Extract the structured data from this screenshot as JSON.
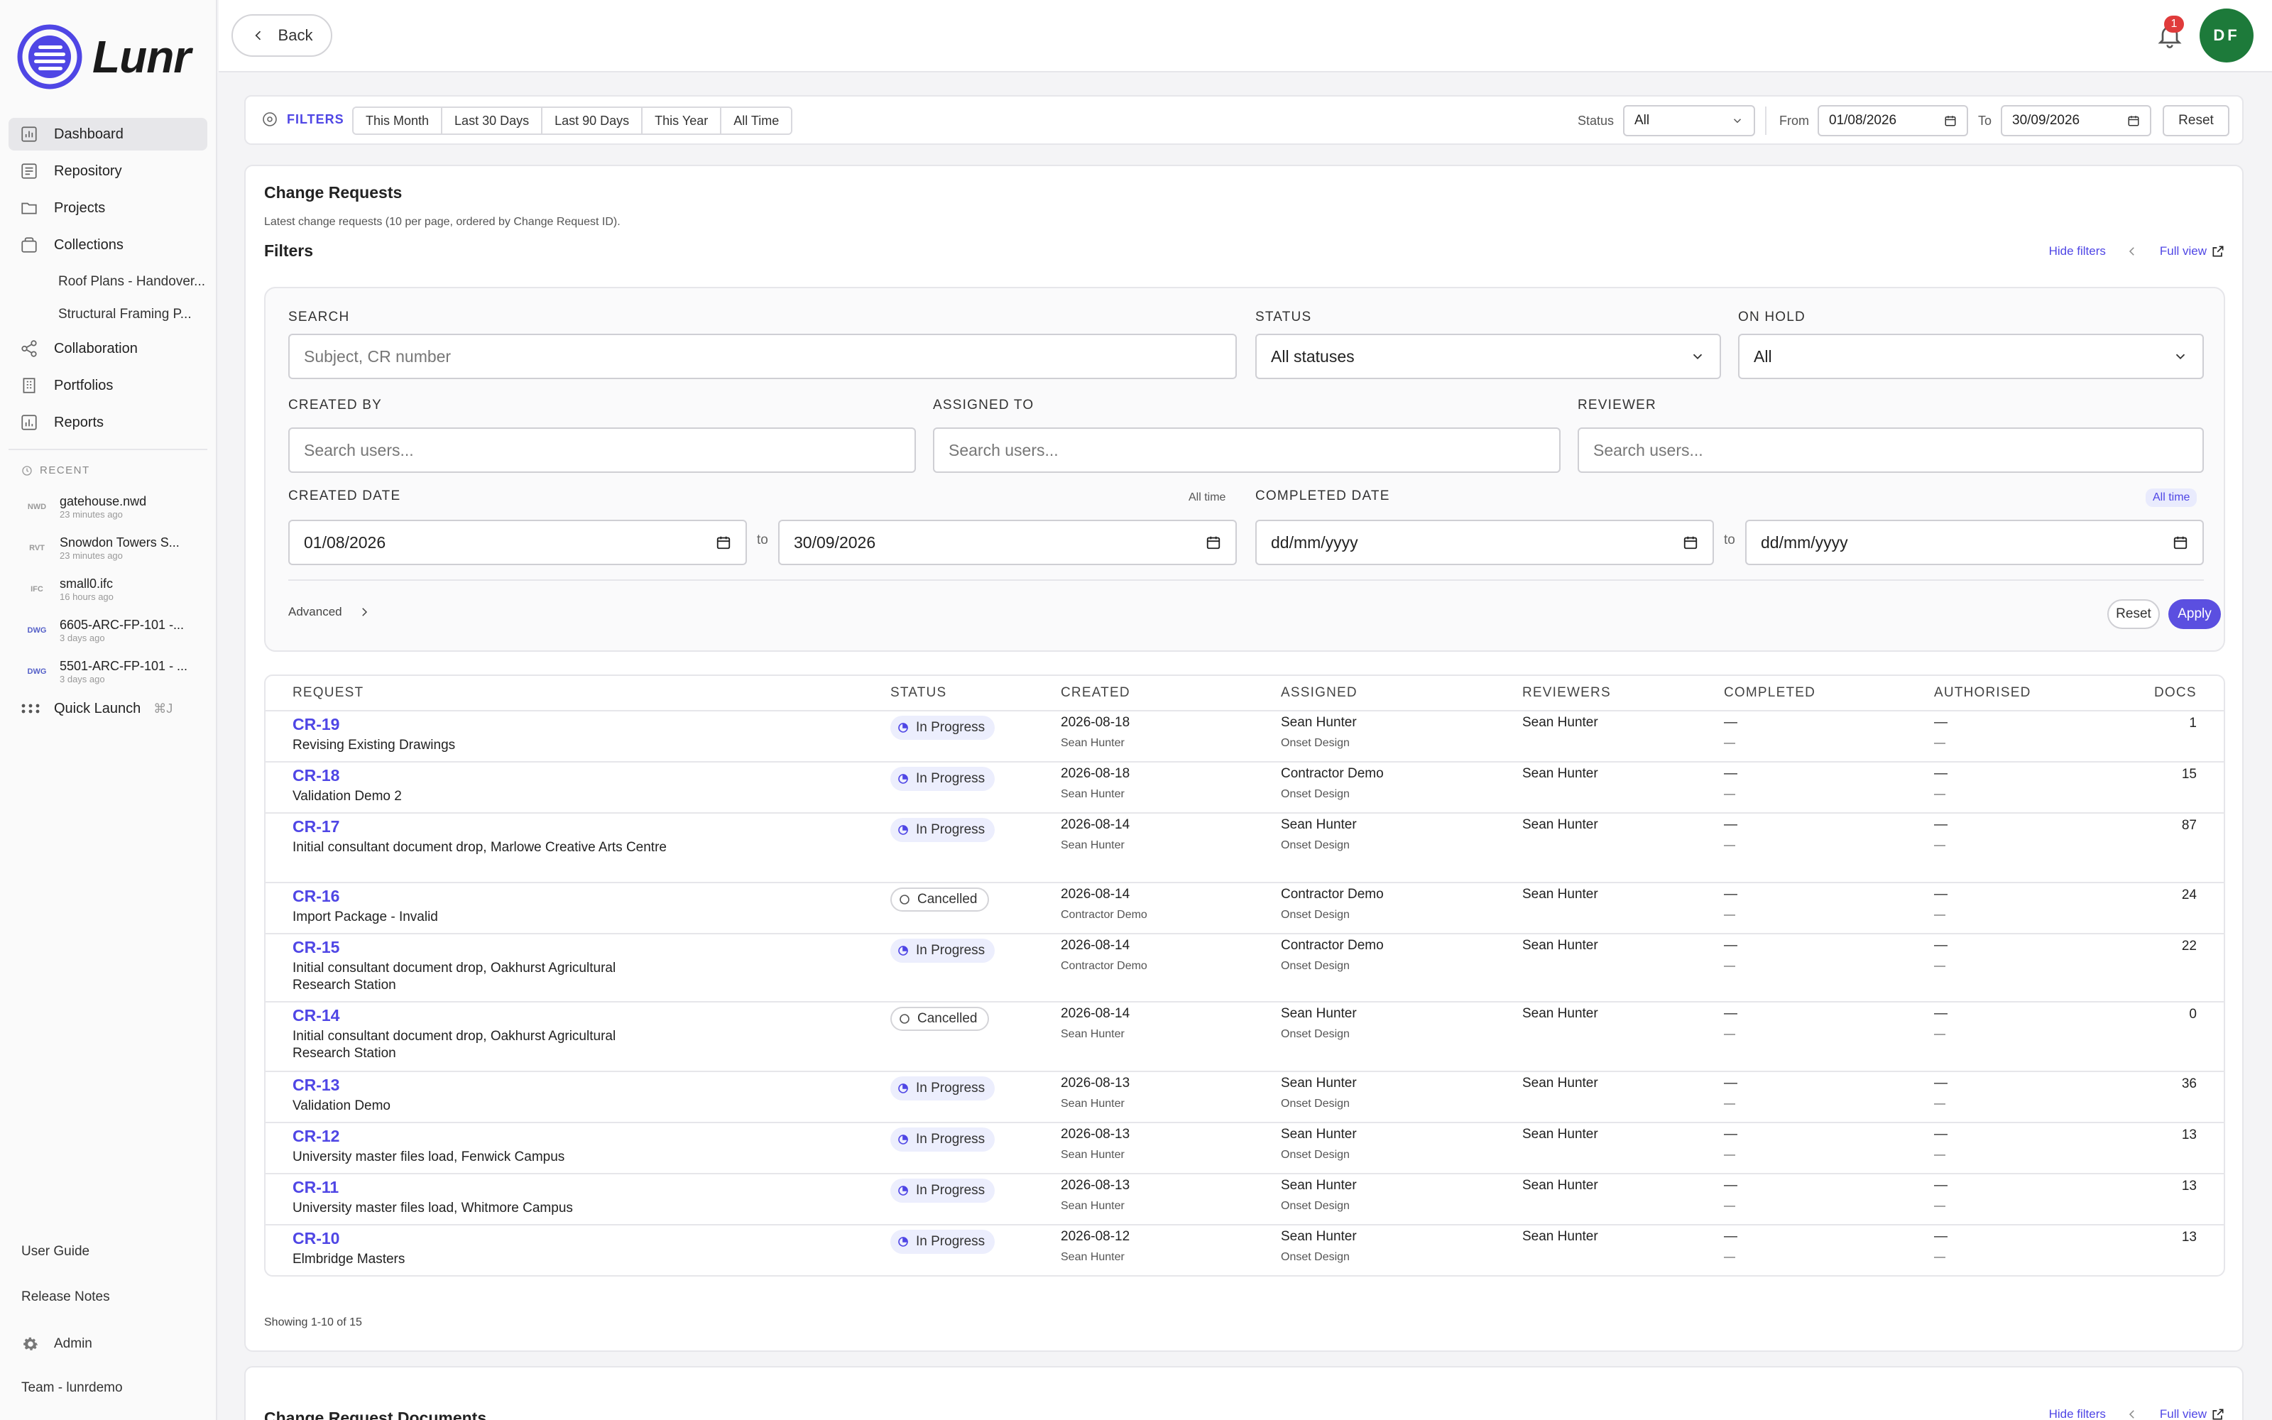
{
  "app": {
    "logo_text": "Lunr",
    "brand_color": "#4f46e5"
  },
  "sidebar": {
    "nav": [
      {
        "label": "Dashboard",
        "icon": "dashboard-icon"
      },
      {
        "label": "Repository",
        "icon": "repository-icon"
      },
      {
        "label": "Projects",
        "icon": "folder-icon"
      },
      {
        "label": "Collections",
        "icon": "collections-icon"
      }
    ],
    "collections": [
      "Roof Plans - Handover...",
      "Structural Framing P..."
    ],
    "nav2": [
      {
        "label": "Collaboration",
        "icon": "share-icon"
      },
      {
        "label": "Portfolios",
        "icon": "building-icon"
      },
      {
        "label": "Reports",
        "icon": "chart-icon"
      }
    ],
    "recent_label": "RECENT",
    "recent": [
      {
        "type": "NWD",
        "name": "gatehouse.nwd",
        "time": "23 minutes ago"
      },
      {
        "type": "RVT",
        "name": "Snowdon Towers S...",
        "time": "23 minutes ago"
      },
      {
        "type": "IFC",
        "name": "small0.ifc",
        "time": "16 hours ago"
      },
      {
        "type": "DWG",
        "name": "6605-ARC-FP-101 -...",
        "time": "3 days ago"
      },
      {
        "type": "DWG",
        "name": "5501-ARC-FP-101 - ...",
        "time": "3 days ago"
      }
    ],
    "quick_launch": "Quick Launch",
    "quick_kbd": "⌘J",
    "user_guide": "User Guide",
    "release_notes": "Release Notes",
    "admin": "Admin",
    "team": "Team - lunrdemo"
  },
  "topbar": {
    "back": "Back",
    "notifications": "1",
    "avatar": "DF"
  },
  "global_filters": {
    "label": "FILTERS",
    "ranges": [
      "This Month",
      "Last 30 Days",
      "Last 90 Days",
      "This Year",
      "All Time"
    ],
    "status_label": "Status",
    "status_value": "All",
    "from_label": "From",
    "from_value": "01/08/2026",
    "to_label": "To",
    "to_value": "30/09/2026",
    "reset": "Reset"
  },
  "card": {
    "title": "Change Requests",
    "subtitle": "Latest change requests (10 per page, ordered by Change Request ID).",
    "filters_title": "Filters",
    "hide_filters": "Hide filters",
    "full_view": "Full view",
    "showing": "Showing 1-10 of 15"
  },
  "filters": {
    "search_label": "SEARCH",
    "search_placeholder": "Subject, CR number",
    "status_label": "STATUS",
    "status_value": "All statuses",
    "onhold_label": "ON HOLD",
    "onhold_value": "All",
    "created_by_label": "CREATED BY",
    "assigned_to_label": "ASSIGNED TO",
    "reviewer_label": "REVIEWER",
    "users_placeholder": "Search users...",
    "created_date_label": "CREATED DATE",
    "created_all_time": "All time",
    "created_from": "01/08/2026",
    "created_to": "30/09/2026",
    "to": "to",
    "completed_date_label": "COMPLETED DATE",
    "completed_all_time": "All time",
    "date_placeholder": "dd/mm/yyyy",
    "advanced": "Advanced",
    "reset": "Reset",
    "apply": "Apply"
  },
  "table": {
    "headers": [
      "REQUEST",
      "STATUS",
      "CREATED",
      "ASSIGNED",
      "REVIEWERS",
      "COMPLETED",
      "AUTHORISED",
      "DOCS"
    ],
    "rows": [
      {
        "id": "CR-19",
        "subject": "Revising Existing Drawings",
        "status": "In Progress",
        "created": "2026-08-18",
        "created_by": "Sean Hunter",
        "assigned": "Sean Hunter",
        "assigned_org": "Onset Design",
        "reviewers": "Sean Hunter",
        "completed": "—",
        "completed_sub": "—",
        "authorised": "—",
        "authorised_sub": "—",
        "docs": "1"
      },
      {
        "id": "CR-18",
        "subject": "Validation Demo 2",
        "status": "In Progress",
        "created": "2026-08-18",
        "created_by": "Sean Hunter",
        "assigned": "Contractor Demo",
        "assigned_org": "Onset Design",
        "reviewers": "Sean Hunter",
        "completed": "—",
        "completed_sub": "—",
        "authorised": "—",
        "authorised_sub": "—",
        "docs": "15"
      },
      {
        "id": "CR-17",
        "subject": "Initial consultant document drop, Marlowe Creative Arts Centre",
        "status": "In Progress",
        "created": "2026-08-14",
        "created_by": "Sean Hunter",
        "assigned": "Sean Hunter",
        "assigned_org": "Onset Design",
        "reviewers": "Sean Hunter",
        "completed": "—",
        "completed_sub": "—",
        "authorised": "—",
        "authorised_sub": "—",
        "docs": "87"
      },
      {
        "id": "CR-16",
        "subject": "Import Package - Invalid",
        "status": "Cancelled",
        "created": "2026-08-14",
        "created_by": "Contractor Demo",
        "assigned": "Contractor Demo",
        "assigned_org": "Onset Design",
        "reviewers": "Sean Hunter",
        "completed": "—",
        "completed_sub": "—",
        "authorised": "—",
        "authorised_sub": "—",
        "docs": "24"
      },
      {
        "id": "CR-15",
        "subject": "Initial consultant document drop, Oakhurst Agricultural Research Station",
        "status": "In Progress",
        "created": "2026-08-14",
        "created_by": "Contractor Demo",
        "assigned": "Contractor Demo",
        "assigned_org": "Onset Design",
        "reviewers": "Sean Hunter",
        "completed": "—",
        "completed_sub": "—",
        "authorised": "—",
        "authorised_sub": "—",
        "docs": "22"
      },
      {
        "id": "CR-14",
        "subject": "Initial consultant document drop, Oakhurst Agricultural Research Station",
        "status": "Cancelled",
        "created": "2026-08-14",
        "created_by": "Sean Hunter",
        "assigned": "Sean Hunter",
        "assigned_org": "Onset Design",
        "reviewers": "Sean Hunter",
        "completed": "—",
        "completed_sub": "—",
        "authorised": "—",
        "authorised_sub": "—",
        "docs": "0"
      },
      {
        "id": "CR-13",
        "subject": "Validation Demo",
        "status": "In Progress",
        "created": "2026-08-13",
        "created_by": "Sean Hunter",
        "assigned": "Sean Hunter",
        "assigned_org": "Onset Design",
        "reviewers": "Sean Hunter",
        "completed": "—",
        "completed_sub": "—",
        "authorised": "—",
        "authorised_sub": "—",
        "docs": "36"
      },
      {
        "id": "CR-12",
        "subject": "University master files load, Fenwick Campus",
        "status": "In Progress",
        "created": "2026-08-13",
        "created_by": "Sean Hunter",
        "assigned": "Sean Hunter",
        "assigned_org": "Onset Design",
        "reviewers": "Sean Hunter",
        "completed": "—",
        "completed_sub": "—",
        "authorised": "—",
        "authorised_sub": "—",
        "docs": "13"
      },
      {
        "id": "CR-11",
        "subject": "University master files load, Whitmore Campus",
        "status": "In Progress",
        "created": "2026-08-13",
        "created_by": "Sean Hunter",
        "assigned": "Sean Hunter",
        "assigned_org": "Onset Design",
        "reviewers": "Sean Hunter",
        "completed": "—",
        "completed_sub": "—",
        "authorised": "—",
        "authorised_sub": "—",
        "docs": "13"
      },
      {
        "id": "CR-10",
        "subject": "Elmbridge Masters",
        "status": "In Progress",
        "created": "2026-08-12",
        "created_by": "Sean Hunter",
        "assigned": "Sean Hunter",
        "assigned_org": "Onset Design",
        "reviewers": "Sean Hunter",
        "completed": "—",
        "completed_sub": "—",
        "authorised": "—",
        "authorised_sub": "—",
        "docs": "13"
      }
    ]
  },
  "card2": {
    "title": "Change Request Documents",
    "hide_filters": "Hide filters",
    "full_view": "Full view"
  }
}
